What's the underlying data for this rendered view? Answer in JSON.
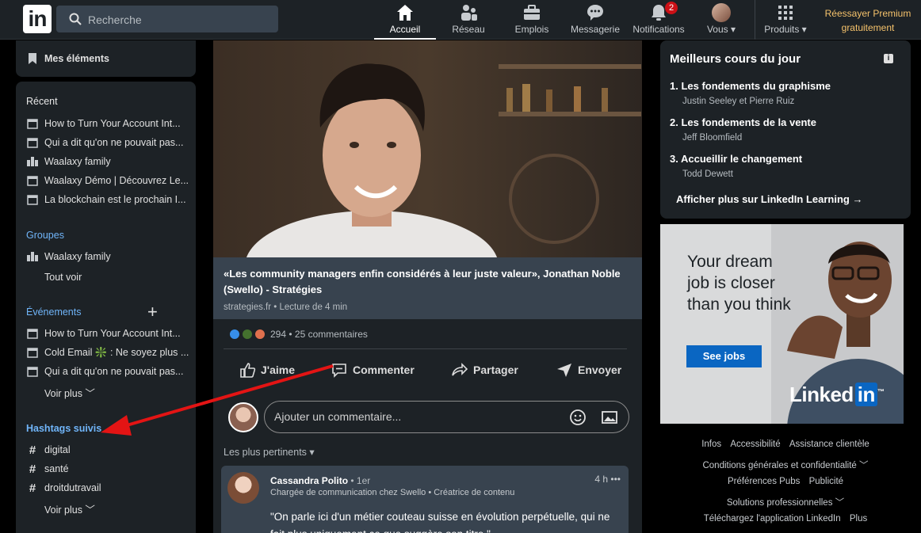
{
  "nav": {
    "search_placeholder": "Recherche",
    "items": [
      {
        "label": "Accueil"
      },
      {
        "label": "Réseau"
      },
      {
        "label": "Emplois"
      },
      {
        "label": "Messagerie"
      },
      {
        "label": "Notifications",
        "badge": "2"
      },
      {
        "label": "Vous ▾"
      },
      {
        "label": "Produits ▾"
      }
    ],
    "premium": "Réessayer Premium gratuitement"
  },
  "left": {
    "saved": "Mes éléments",
    "recent_title": "Récent",
    "recent": [
      "How to Turn Your Account Int...",
      "Qui a dit qu'on ne pouvait pas...",
      "Waalaxy family",
      "Waalaxy Démo | Découvrez Le...",
      "La blockchain est le prochain I..."
    ],
    "groups_title": "Groupes",
    "groups": [
      "Waalaxy family"
    ],
    "groups_all": "Tout voir",
    "events_title": "Événements",
    "events_add": "+",
    "events": [
      "How to Turn Your Account Int...",
      "Cold Email ❇️ : Ne soyez plus ...",
      "Qui a dit qu'on ne pouvait pas..."
    ],
    "events_more": "Voir plus ﹀",
    "hashtags_title": "Hashtags suivis",
    "hashtags": [
      "digital",
      "santé",
      "droitdutravail"
    ],
    "hashtags_more": "Voir plus ﹀"
  },
  "feed": {
    "article_title": "«Les community managers enfin considérés à leur juste valeur», Jonathan Noble (Swello) - Stratégies",
    "article_source": "strategies.fr • Lecture de 4 min",
    "reactions": "294 • 25 commentaires",
    "actions": [
      "J'aime",
      "Commenter",
      "Partager",
      "Envoyer"
    ],
    "comment_placeholder": "Ajouter un commentaire...",
    "sort": "Les plus pertinents ▾",
    "comment": {
      "name": "Cassandra Polito",
      "degree": "• 1er",
      "role": "Chargée de communication chez Swello • Créatrice de contenu",
      "time": "4 h  •••",
      "text": "\"On parle ici d'un métier couteau suisse en évolution perpétuelle, qui ne fait plus uniquement ce que suggère son titre.\""
    }
  },
  "right": {
    "title": "Meilleurs cours du jour",
    "info": "i",
    "courses": [
      {
        "title": "1. Les fondements du graphisme",
        "author": "Justin Seeley et Pierre Ruiz"
      },
      {
        "title": "2. Les fondements de la vente",
        "author": "Jeff Bloomfield"
      },
      {
        "title": "3. Accueillir le changement",
        "author": "Todd Dewett"
      }
    ],
    "more": "Afficher plus sur LinkedIn Learning →",
    "ad": {
      "text": "Your dream job is closer than you think",
      "button": "See jobs",
      "logo": "Linked",
      "logo_in": "in",
      "logo_tm": "™"
    },
    "footer": [
      [
        "Infos",
        "Accessibilité",
        "Assistance clientèle"
      ],
      [
        "Conditions générales et confidentialité ﹀"
      ],
      [
        "Préférences Pubs",
        "Publicité"
      ],
      [
        "Solutions professionnelles ﹀"
      ],
      [
        "Téléchargez l'application LinkedIn",
        "Plus"
      ]
    ]
  }
}
